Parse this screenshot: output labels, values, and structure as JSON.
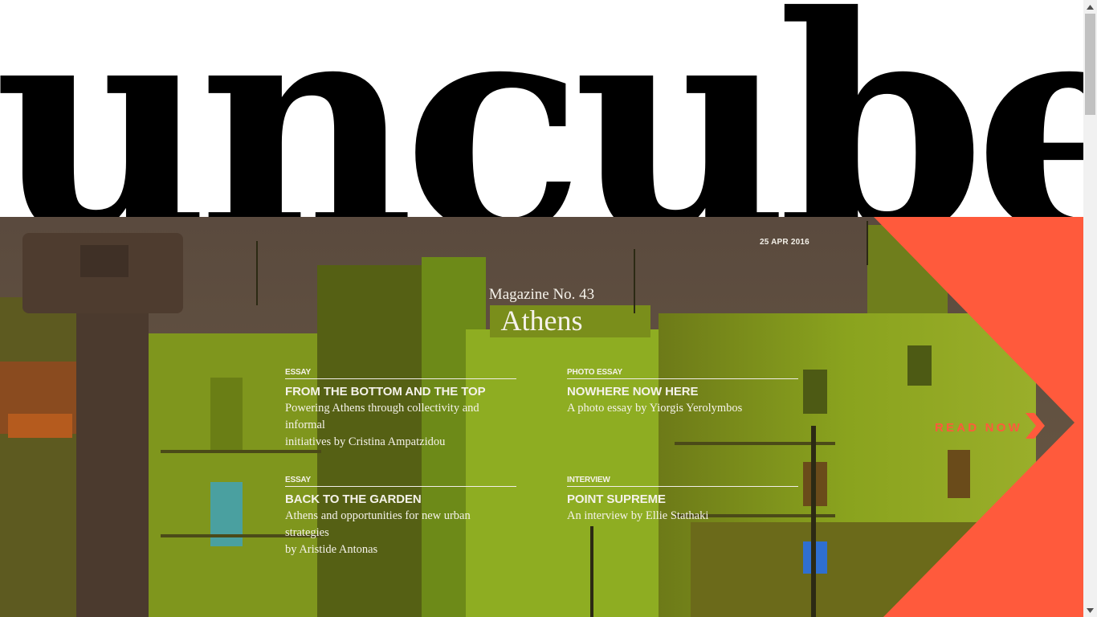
{
  "masthead": {
    "logo": "uncube"
  },
  "issue": {
    "date": "25 APR 2016",
    "kicker": "Magazine No. 43",
    "title": "Athens"
  },
  "articles": [
    {
      "category": "ESSAY",
      "title": "FROM THE BOTTOM AND THE TOP",
      "subtitle_line1": "Powering Athens through collectivity and informal",
      "subtitle_line2": "initiatives by Cristina Ampatzidou"
    },
    {
      "category": "PHOTO ESSAY",
      "title": "NOWHERE NOW HERE",
      "subtitle_line1": "A photo essay by Yiorgis Yerolymbos",
      "subtitle_line2": ""
    },
    {
      "category": "ESSAY",
      "title": "BACK TO THE GARDEN",
      "subtitle_line1": "Athens and opportunities for new urban strategies",
      "subtitle_line2": "by Aristide Antonas"
    },
    {
      "category": "INTERVIEW",
      "title": "POINT SUPREME",
      "subtitle_line1": "An interview by Ellie Stathaki",
      "subtitle_line2": ""
    }
  ],
  "cta": {
    "read_now": "READ NOW",
    "arrow_icon": "chevron-right-icon"
  },
  "colors": {
    "accent": "#ff5a3c",
    "overlay_green": "#8fa81c",
    "text_light": "#f5f2ea"
  }
}
